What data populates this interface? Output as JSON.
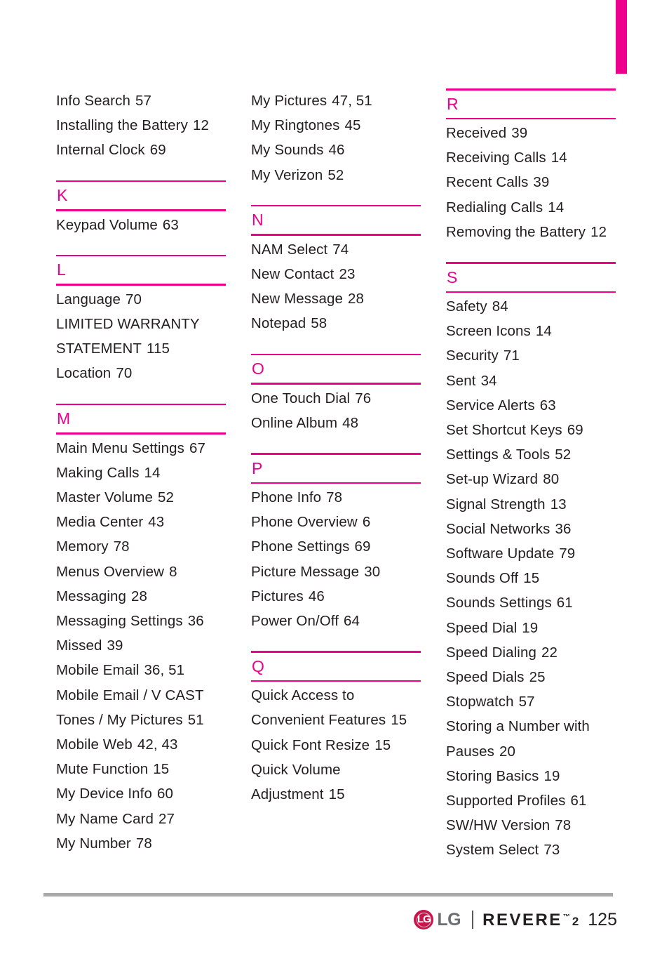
{
  "page": {
    "kind": "index",
    "page_number": "125",
    "accent_color": "#ec008c",
    "text_color": "#231f20",
    "footer_rule_color": "#a9a9a9"
  },
  "thumb_tab": {
    "color": "#ec008c"
  },
  "columns": [
    {
      "id": "column-1",
      "blocks": [
        {
          "type": "entries",
          "entries": [
            {
              "label": "Info Search",
              "page": "57"
            },
            {
              "label": "Installing the Battery",
              "page": "12"
            },
            {
              "label": "Internal Clock",
              "page": "69"
            }
          ]
        },
        {
          "type": "letter",
          "letter": "K",
          "entries": [
            {
              "label": "Keypad Volume",
              "page": "63"
            }
          ]
        },
        {
          "type": "letter",
          "letter": "L",
          "entries": [
            {
              "label": "Language",
              "page": "70"
            },
            {
              "label": "LIMITED WARRANTY",
              "page": ""
            },
            {
              "label": "STATEMENT",
              "page": "115",
              "continuation": true
            },
            {
              "label": "Location",
              "page": "70"
            }
          ]
        },
        {
          "type": "letter",
          "letter": "M",
          "entries": [
            {
              "label": "Main Menu Settings",
              "page": "67"
            },
            {
              "label": "Making Calls",
              "page": "14"
            },
            {
              "label": "Master Volume",
              "page": "52"
            },
            {
              "label": "Media Center",
              "page": "43"
            },
            {
              "label": "Memory",
              "page": "78"
            },
            {
              "label": "Menus Overview",
              "page": "8"
            },
            {
              "label": "Messaging",
              "page": "28"
            },
            {
              "label": "Messaging Settings",
              "page": "36"
            },
            {
              "label": "Missed",
              "page": "39"
            },
            {
              "label": "Mobile Email",
              "page": "36, 51"
            },
            {
              "label": "Mobile Email / V CAST",
              "page": ""
            },
            {
              "label": "Tones / My Pictures",
              "page": "51",
              "continuation": true
            },
            {
              "label": "Mobile Web",
              "page": "42, 43"
            },
            {
              "label": "Mute Function",
              "page": "15"
            },
            {
              "label": "My Device Info",
              "page": "60"
            },
            {
              "label": "My Name Card",
              "page": "27"
            },
            {
              "label": "My Number",
              "page": "78"
            }
          ]
        }
      ]
    },
    {
      "id": "column-2",
      "blocks": [
        {
          "type": "entries",
          "entries": [
            {
              "label": "My Pictures",
              "page": "47, 51"
            },
            {
              "label": "My Ringtones",
              "page": "45"
            },
            {
              "label": "My Sounds",
              "page": "46"
            },
            {
              "label": "My Verizon",
              "page": "52"
            }
          ]
        },
        {
          "type": "letter",
          "letter": "N",
          "entries": [
            {
              "label": "NAM Select",
              "page": "74"
            },
            {
              "label": "New Contact",
              "page": "23"
            },
            {
              "label": "New Message",
              "page": "28"
            },
            {
              "label": "Notepad",
              "page": "58"
            }
          ]
        },
        {
          "type": "letter",
          "letter": "O",
          "entries": [
            {
              "label": "One Touch Dial",
              "page": "76"
            },
            {
              "label": "Online Album",
              "page": "48"
            }
          ]
        },
        {
          "type": "letter",
          "letter": "P",
          "entries": [
            {
              "label": "Phone Info",
              "page": "78"
            },
            {
              "label": "Phone Overview",
              "page": "6"
            },
            {
              "label": "Phone Settings",
              "page": "69"
            },
            {
              "label": "Picture Message",
              "page": "30"
            },
            {
              "label": "Pictures",
              "page": "46"
            },
            {
              "label": "Power On/Off",
              "page": "64"
            }
          ]
        },
        {
          "type": "letter",
          "letter": "Q",
          "entries": [
            {
              "label": "Quick Access to",
              "page": ""
            },
            {
              "label": "Convenient Features",
              "page": "15",
              "continuation": true
            },
            {
              "label": "Quick Font Resize",
              "page": "15"
            },
            {
              "label": "Quick Volume",
              "page": ""
            },
            {
              "label": "Adjustment",
              "page": "15",
              "continuation": true
            }
          ]
        }
      ]
    },
    {
      "id": "column-3",
      "blocks": [
        {
          "type": "letter",
          "letter": "R",
          "first": true,
          "entries": [
            {
              "label": "Received",
              "page": "39"
            },
            {
              "label": "Receiving Calls",
              "page": "14"
            },
            {
              "label": "Recent Calls",
              "page": "39"
            },
            {
              "label": "Redialing Calls",
              "page": "14"
            },
            {
              "label": "Removing the Battery",
              "page": "12"
            }
          ]
        },
        {
          "type": "letter",
          "letter": "S",
          "entries": [
            {
              "label": "Safety",
              "page": "84"
            },
            {
              "label": "Screen Icons",
              "page": "14"
            },
            {
              "label": "Security",
              "page": "71"
            },
            {
              "label": "Sent",
              "page": "34"
            },
            {
              "label": "Service Alerts",
              "page": "63"
            },
            {
              "label": "Set Shortcut Keys",
              "page": "69"
            },
            {
              "label": "Settings & Tools",
              "page": "52"
            },
            {
              "label": "Set-up Wizard",
              "page": "80"
            },
            {
              "label": "Signal Strength",
              "page": "13"
            },
            {
              "label": "Social Networks",
              "page": "36"
            },
            {
              "label": "Software Update",
              "page": "79"
            },
            {
              "label": "Sounds Off",
              "page": "15"
            },
            {
              "label": "Sounds Settings",
              "page": "61"
            },
            {
              "label": "Speed Dial",
              "page": "19"
            },
            {
              "label": "Speed Dialing",
              "page": "22"
            },
            {
              "label": "Speed Dials",
              "page": "25"
            },
            {
              "label": "Stopwatch",
              "page": "57"
            },
            {
              "label": "Storing a Number with",
              "page": ""
            },
            {
              "label": "Pauses",
              "page": "20",
              "continuation": true
            },
            {
              "label": "Storing Basics",
              "page": "19"
            },
            {
              "label": "Supported Profiles",
              "page": "61"
            },
            {
              "label": "SW/HW Version",
              "page": "78"
            },
            {
              "label": "System Select",
              "page": "73"
            }
          ]
        }
      ]
    }
  ],
  "footer": {
    "brand": "LG",
    "brand_mark_letters": "LG",
    "model": "REVERE",
    "model_tm": "™",
    "model_suffix": "2",
    "page_number": "125"
  }
}
